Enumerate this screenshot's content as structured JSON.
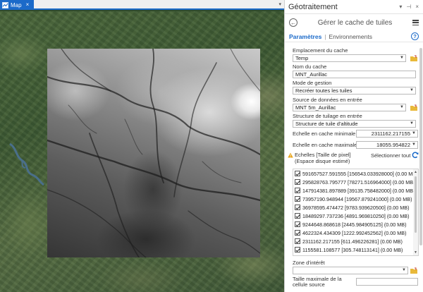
{
  "map": {
    "tab_label": "Map",
    "tab_close": "×",
    "dropdown_glyph": "▾"
  },
  "gp": {
    "pane_title": "Géotraitement",
    "pane_controls": [
      "▾",
      "⊣",
      "×"
    ],
    "tool_title": "Gérer le cache de tuiles",
    "tabs": {
      "parameters": "Paramètres",
      "separator": "|",
      "environments": "Environnements"
    },
    "help_glyph": "?",
    "cache_location": {
      "label": "Emplacement du cache",
      "value": "Temp"
    },
    "cache_name": {
      "label": "Nom du cache",
      "value": "MNT_Aurillac"
    },
    "manage_mode": {
      "label": "Mode de gestion",
      "value": "Recréer toutes les tuiles"
    },
    "input_source": {
      "label": "Source de données en entrée",
      "value": "MNT 5m_Aurillac"
    },
    "tiling_scheme": {
      "label": "Structure de tuilage en entrée",
      "value": "Structure de tuile d'altitude"
    },
    "min_scale": {
      "label": "Echelle en cache minimale",
      "value": "2311162.217155"
    },
    "max_scale": {
      "label": "Echelle en cache maximale",
      "value": "18055.954822"
    },
    "scales": {
      "label": "Echelles [Taille de pixel] (Espace disque estimé)",
      "select_all": "Sélectionner tout",
      "items": [
        "591657527.591555 [156543.033928000] (0.00 MB)",
        "295828763.795777 [78271.516964000] (0.00 MB)",
        "147914381.897889 [39135.758482000] (0.00 MB)",
        "73957190.948944 [19567.879241000] (0.00 MB)",
        "36978595.474472 [9783.939620500] (0.00 MB)",
        "18489297.737236 [4891.969810250] (0.00 MB)",
        "9244648.868618 [2445.984905125] (0.00 MB)",
        "4622324.434309 [1222.992452562] (0.00 MB)",
        "2311162.217155 [611.496226281] (0.00 MB)",
        "1155581.108577 [305.748113141] (0.00 MB)"
      ]
    },
    "area_of_interest": {
      "label": "Zone d'intérêt",
      "value": ""
    },
    "max_cell_size": {
      "label": "Taille maximale de la cellule source",
      "value": ""
    }
  },
  "colors": {
    "accent": "#1b6ac9",
    "warning": "#e8a317",
    "folder": "#e9b93a"
  }
}
